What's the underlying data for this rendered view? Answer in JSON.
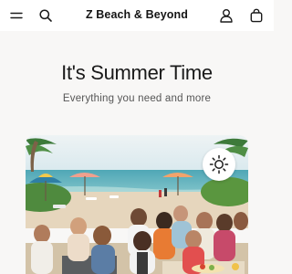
{
  "header": {
    "brand": "Z Beach & Beyond",
    "icons": [
      "menu-icon",
      "search-icon",
      "account-icon",
      "shopping-bag-icon"
    ]
  },
  "hero": {
    "title": "It's Summer Time",
    "subtitle": "Everything you need and more",
    "image": "beach-party-photo",
    "toggle_icon": "sun-icon"
  }
}
